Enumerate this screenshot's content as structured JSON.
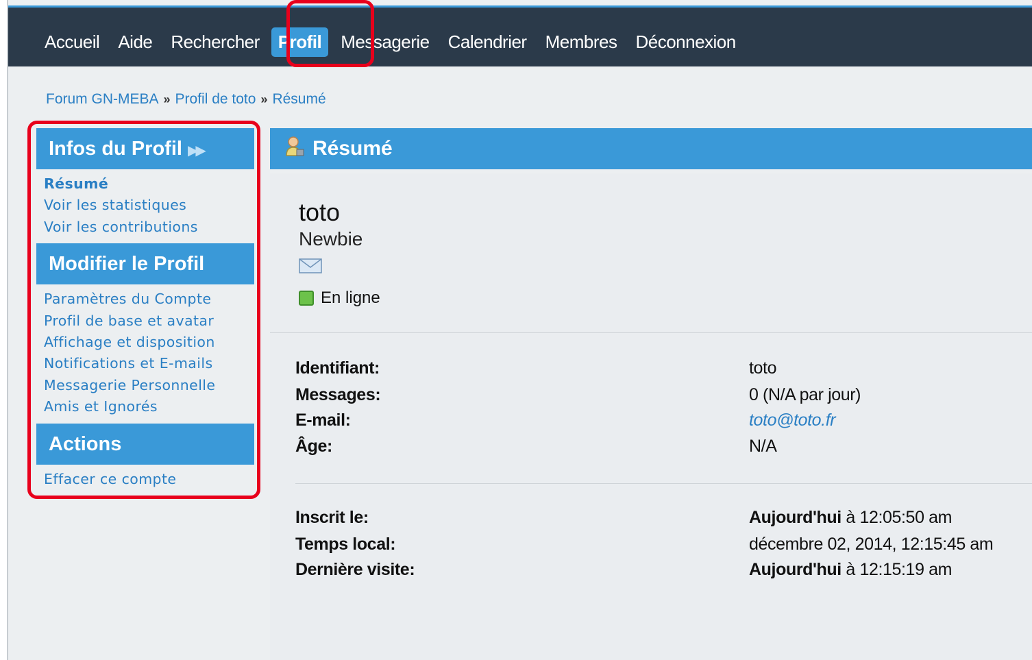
{
  "nav": {
    "items": [
      "Accueil",
      "Aide",
      "Rechercher",
      "Profil",
      "Messagerie",
      "Calendrier",
      "Membres",
      "Déconnexion"
    ],
    "active": "Profil"
  },
  "breadcrumb": {
    "items": [
      "Forum GN-MEBA",
      "Profil de toto",
      "Résumé"
    ],
    "separator": "»"
  },
  "sidebar": {
    "sections": [
      {
        "title": "Infos du Profil",
        "arrows": "▶▶",
        "links": [
          "Résumé",
          "Voir les statistiques",
          "Voir les contributions"
        ],
        "current": "Résumé"
      },
      {
        "title": "Modifier le Profil",
        "links": [
          "Paramètres du Compte",
          "Profil de base et avatar",
          "Affichage et disposition",
          "Notifications et E-mails",
          "Messagerie Personnelle",
          "Amis et Ignorés"
        ]
      },
      {
        "title": "Actions",
        "links": [
          "Effacer ce compte"
        ]
      }
    ]
  },
  "main": {
    "title": "Résumé",
    "user": {
      "name": "toto",
      "rank": "Newbie",
      "status": "En ligne"
    },
    "details": [
      {
        "label": "Identifiant:",
        "value": "toto"
      },
      {
        "label": "Messages:",
        "value": "0 (N/A par jour)"
      },
      {
        "label": "E-mail:",
        "value": "toto@toto.fr",
        "link": true
      },
      {
        "label": "Âge:",
        "value": "N/A"
      }
    ],
    "dates": [
      {
        "label": "Inscrit le:",
        "strong": "Aujourd'hui",
        "rest": " à 12:05:50 am"
      },
      {
        "label": "Temps local:",
        "strong": "",
        "rest": "décembre 02, 2014, 12:15:45 am"
      },
      {
        "label": "Dernière visite:",
        "strong": "Aujourd'hui",
        "rest": " à 12:15:19 am"
      }
    ]
  },
  "colors": {
    "accent": "#3a99d8",
    "topbar": "#2b3a4a",
    "link": "#2a7fc4",
    "highlight": "#e8001c",
    "online": "#6cc24a"
  },
  "icons": {
    "user": "user-icon",
    "mail": "envelope-icon",
    "status": "online-status-icon"
  }
}
